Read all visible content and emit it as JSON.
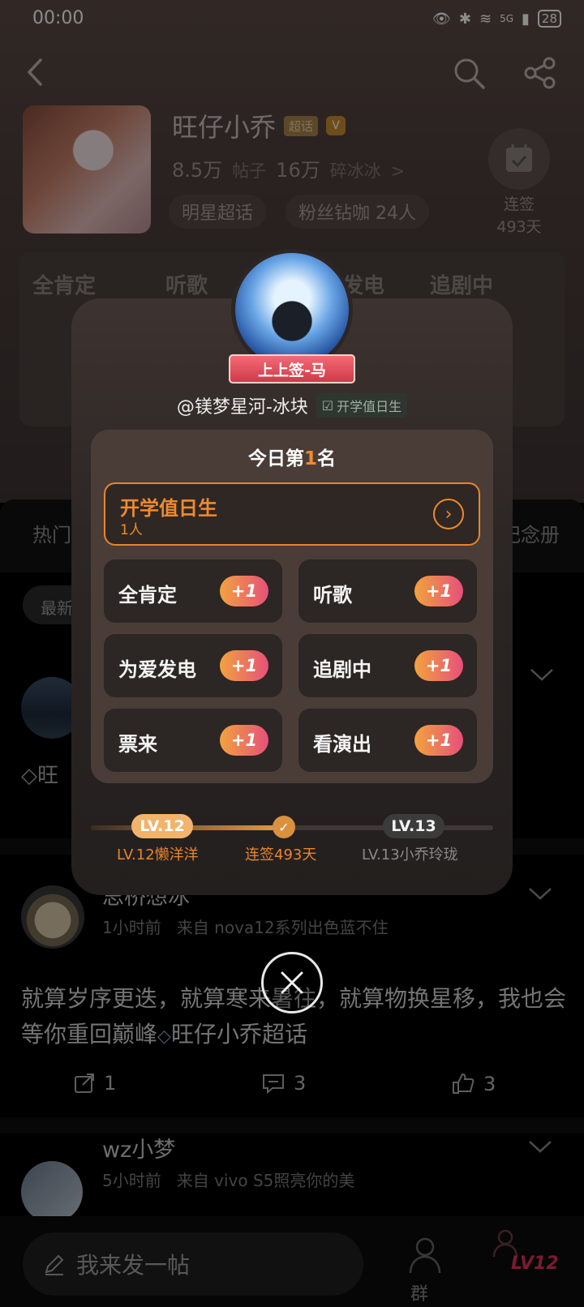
{
  "status_bar": {
    "time": "00:00",
    "network": "5G",
    "battery": "28"
  },
  "topic": {
    "title": "旺仔小乔",
    "badge": "超话",
    "verified_badge": "V",
    "posts_count": "8.5万",
    "posts_label": "帖子",
    "fans_count": "16万",
    "fans_label": "碎冰冰",
    "fans_chevron": ">",
    "pill_star": "明星超话",
    "pill_fans": "粉丝钻咖 24人",
    "checkin_label": "连签",
    "checkin_days": "493天"
  },
  "tag_band": [
    "全肯定",
    "听歌",
    "为爱发电",
    "追剧中"
  ],
  "feed": {
    "tab_left": "热门",
    "tab_right": "纪念册",
    "sort": "最新",
    "post1_tag": "旺",
    "post2": {
      "name": "思桥想冰",
      "time": "1小时前",
      "source": "来自 nova12系列出色蓝不住",
      "text": "就算岁序更迭，就算寒来暑往，就算物换星移，我也会等你重回巅峰",
      "topic": "旺仔小乔超话",
      "shares": "1",
      "comments": "3",
      "likes": "3"
    },
    "post3": {
      "name": "wz小梦",
      "time": "5小时前",
      "source": "来自 vivo S5照亮你的美"
    }
  },
  "bottom_bar": {
    "compose": "我来发一帖",
    "group": "群",
    "level": "LV12"
  },
  "popup": {
    "ribbon": "上上签-马",
    "username": "@镁梦星河-冰块",
    "user_tag": "开学值日生",
    "rank_prefix": "今日第",
    "rank_number": "1",
    "rank_suffix": "名",
    "highlight_title": "开学值日生",
    "highlight_sub": "1人",
    "tags": [
      {
        "label": "全肯定",
        "plus": "+1"
      },
      {
        "label": "听歌",
        "plus": "+1"
      },
      {
        "label": "为爱发电",
        "plus": "+1"
      },
      {
        "label": "追剧中",
        "plus": "+1"
      },
      {
        "label": "票来",
        "plus": "+1"
      },
      {
        "label": "看演出",
        "plus": "+1"
      }
    ],
    "level_from": "LV.12",
    "level_to": "LV.13",
    "level_from_label": "LV.12懒洋洋",
    "streak_label": "连签493天",
    "level_to_label": "LV.13小乔玲珑"
  },
  "colors": {
    "accent_orange": "#f08a2c",
    "plus_gradient_start": "#f2a23f",
    "plus_gradient_end": "#e6507a",
    "ribbon_red": "#e04556"
  },
  "icons": [
    "back-icon",
    "search-icon",
    "share-icon",
    "calendar-icon",
    "chevron-right-icon",
    "close-icon",
    "repost-icon",
    "comment-icon",
    "like-icon",
    "pen-icon",
    "group-icon"
  ]
}
